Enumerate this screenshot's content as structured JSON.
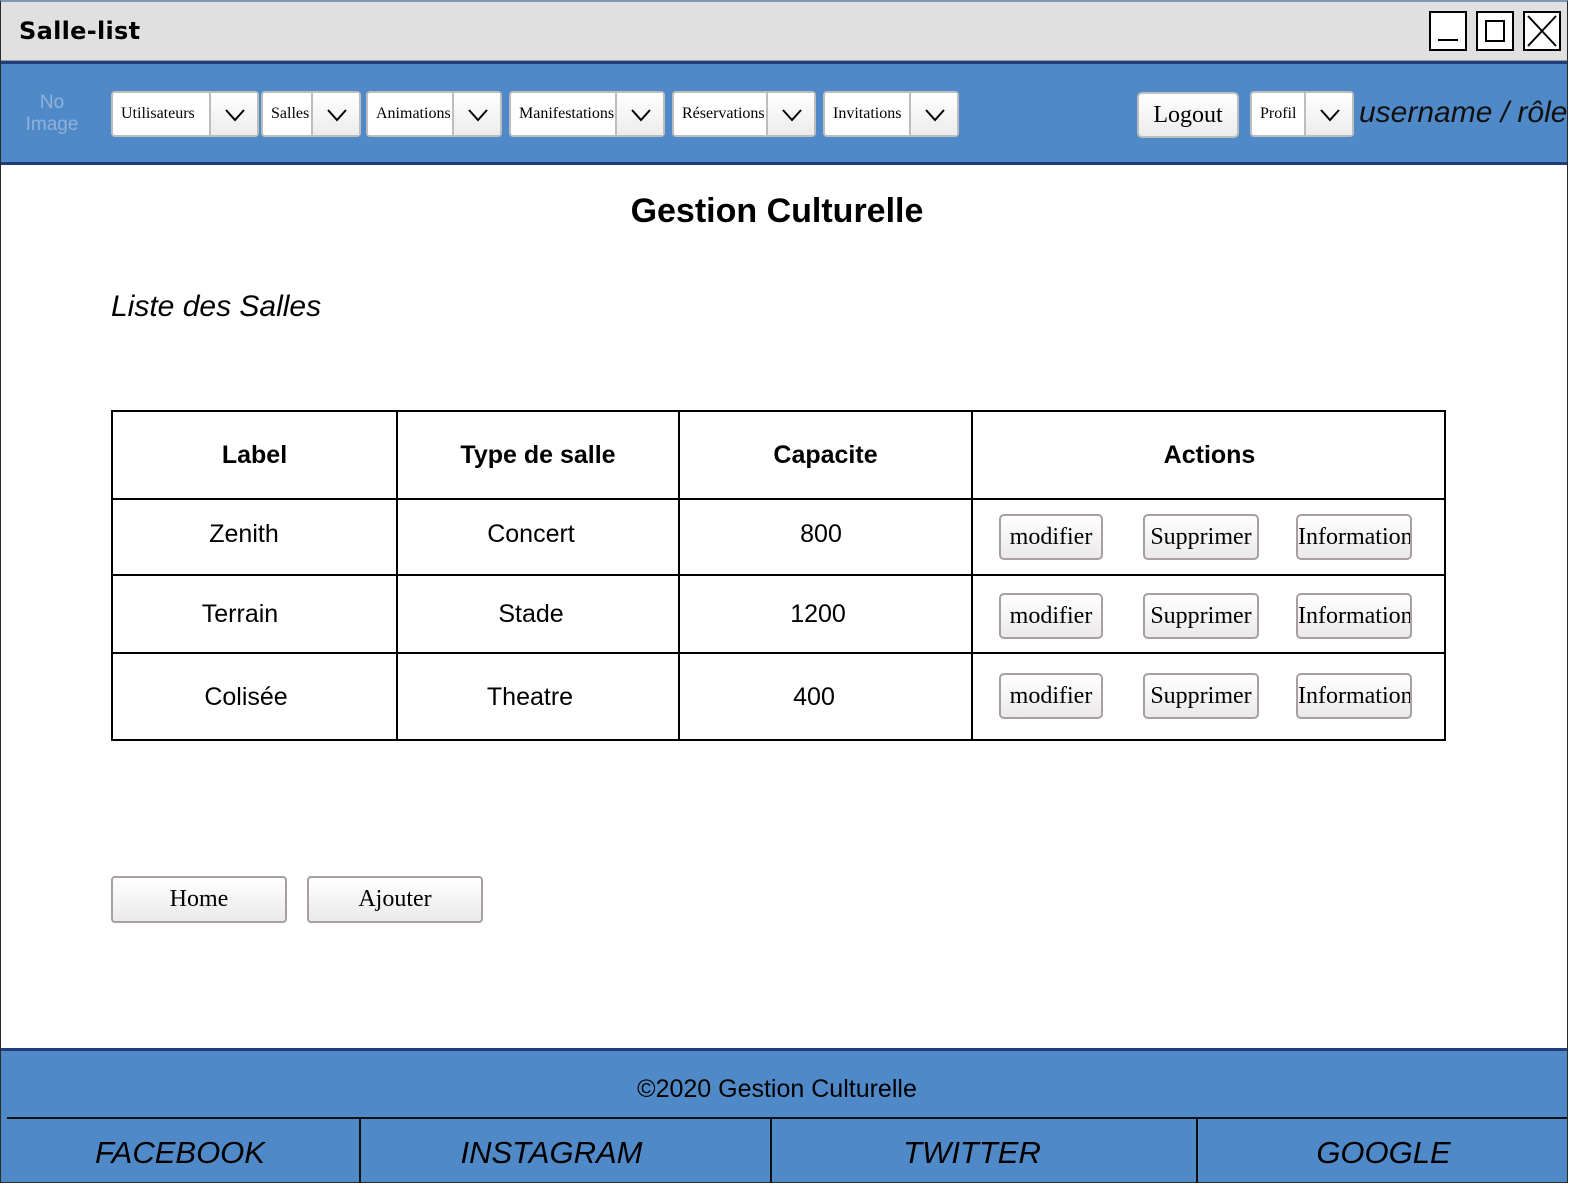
{
  "window": {
    "title": "Salle-list"
  },
  "nav": {
    "logo_text": "No Image",
    "menus": [
      {
        "label": "Utilisateurs"
      },
      {
        "label": "Salles"
      },
      {
        "label": "Animations"
      },
      {
        "label": "Manifestations"
      },
      {
        "label": "Réservations"
      },
      {
        "label": "Invitations"
      }
    ],
    "logout_label": "Logout",
    "profile_label": "Profil",
    "user_role": "username / rôle"
  },
  "main": {
    "title": "Gestion Culturelle",
    "section_title": "Liste des Salles",
    "table": {
      "headers": [
        "Label",
        "Type de salle",
        "Capacite",
        "Actions"
      ],
      "rows": [
        {
          "label": "Zenith",
          "type": "Concert",
          "capacity": "800"
        },
        {
          "label": "Terrain",
          "type": "Stade",
          "capacity": "1200"
        },
        {
          "label": "Colisée",
          "type": "Theatre",
          "capacity": "400"
        }
      ],
      "actions": {
        "edit": "modifier",
        "delete": "Supprimer",
        "info": "Information"
      }
    },
    "home_label": "Home",
    "add_label": "Ajouter"
  },
  "footer": {
    "copyright": "©2020 Gestion Culturelle",
    "social": [
      "FACEBOOK",
      "INSTAGRAM",
      "TWITTER",
      "GOOGLE"
    ]
  },
  "colors": {
    "bar_blue": "#5089c8",
    "border_navy": "#1f3d7a"
  }
}
